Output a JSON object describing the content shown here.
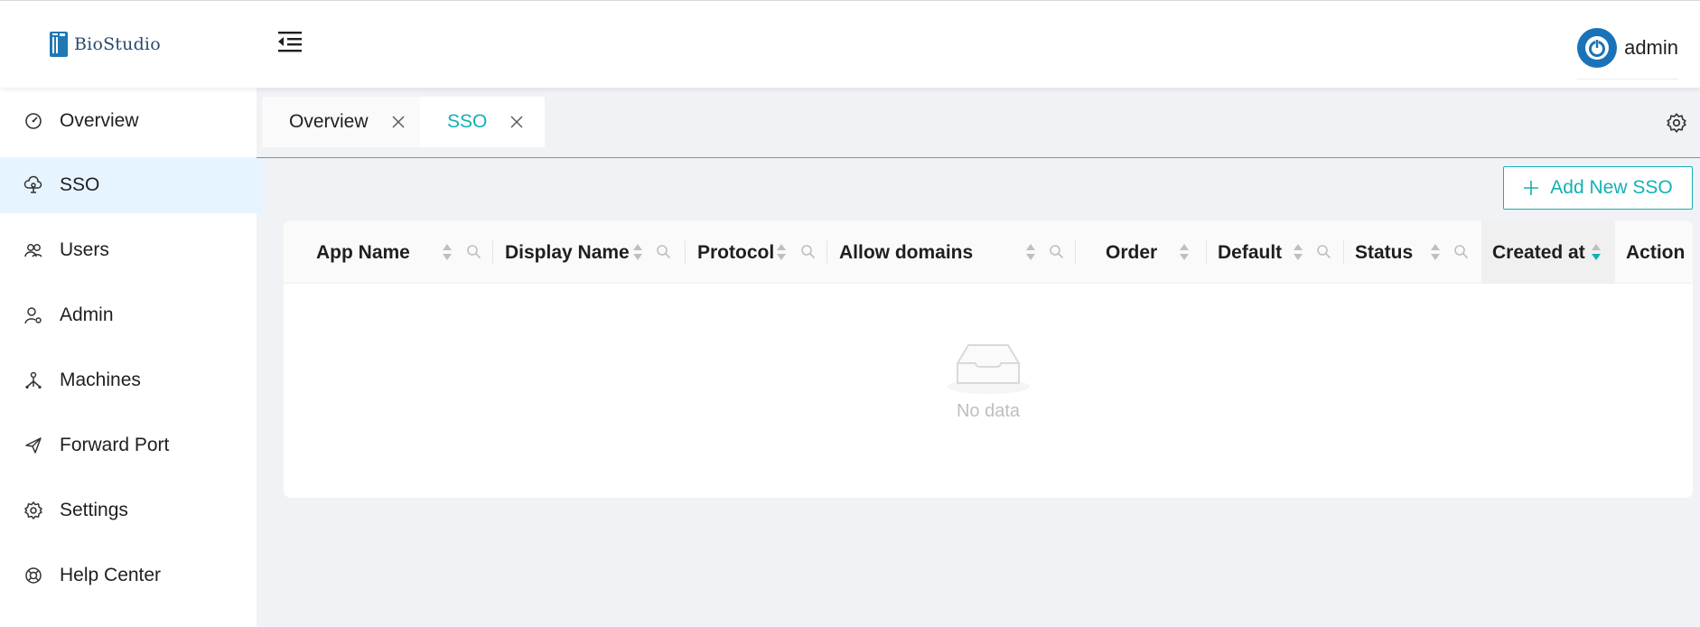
{
  "app": {
    "logo_text": "BioStudio",
    "username": "admin"
  },
  "sidebar": {
    "items": [
      {
        "label": "Overview",
        "icon": "dashboard-icon",
        "active": false
      },
      {
        "label": "SSO",
        "icon": "cloud-key-icon",
        "active": true
      },
      {
        "label": "Users",
        "icon": "users-icon",
        "active": false
      },
      {
        "label": "Admin",
        "icon": "user-admin-icon",
        "active": false
      },
      {
        "label": "Machines",
        "icon": "machines-icon",
        "active": false
      },
      {
        "label": "Forward Port",
        "icon": "send-icon",
        "active": false
      },
      {
        "label": "Settings",
        "icon": "gear-icon",
        "active": false
      },
      {
        "label": "Help Center",
        "icon": "lifebuoy-icon",
        "active": false
      }
    ]
  },
  "tabs": [
    {
      "label": "Overview",
      "active": false
    },
    {
      "label": "SSO",
      "active": true
    }
  ],
  "toolbar": {
    "add_label": "Add New SSO"
  },
  "table": {
    "columns": [
      {
        "label": "App Name",
        "sortable": true,
        "filterable": true
      },
      {
        "label": "Display Name",
        "sortable": true,
        "filterable": true
      },
      {
        "label": "Protocol",
        "sortable": true,
        "filterable": true
      },
      {
        "label": "Allow domains",
        "sortable": true,
        "filterable": true
      },
      {
        "label": "Order",
        "sortable": true,
        "filterable": false
      },
      {
        "label": "Default",
        "sortable": true,
        "filterable": true
      },
      {
        "label": "Status",
        "sortable": true,
        "filterable": true
      },
      {
        "label": "Created at",
        "sortable": true,
        "filterable": false,
        "sort": "descending"
      },
      {
        "label": "Action",
        "sortable": false,
        "filterable": false
      }
    ],
    "rows": [],
    "empty_text": "No data"
  },
  "colors": {
    "accent": "#13b0b6",
    "active_nav_bg": "#e6f4ff",
    "avatar": "#1a73b8"
  }
}
